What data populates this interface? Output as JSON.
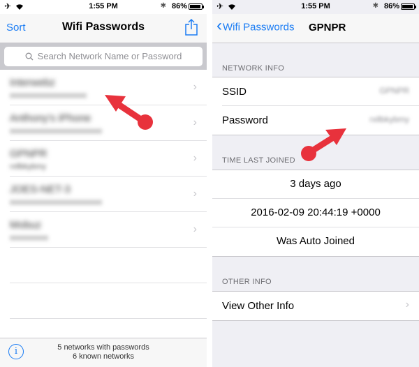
{
  "status": {
    "time": "1:55 PM",
    "battery": "86%",
    "battery_level": 0.86
  },
  "left": {
    "sort_label": "Sort",
    "title": "Wifi Passwords",
    "search_placeholder": "Search Network Name or Password",
    "networks": [
      {
        "name": "Interwebz",
        "password": "xxxxxxxxxxxxxxxxxxxx"
      },
      {
        "name": "Anthony's iPhone",
        "password": "xxxxxxxxxxxxxxxxxxxxxxxx"
      },
      {
        "name": "GPNPR",
        "password": "rxllbkybmy"
      },
      {
        "name": "JOES-NET-3",
        "password": "xxxxxxxxxxxxxxxxxxxxxxxx"
      },
      {
        "name": "Mobuz",
        "password": "xxxxxxxxxx"
      }
    ],
    "footer_line1": "5 networks with passwords",
    "footer_line2": "6 known networks"
  },
  "right": {
    "back_label": "Wifi Passwords",
    "title": "GPNPR",
    "network_info_header": "NETWORK INFO",
    "ssid_label": "SSID",
    "ssid_value": "GPNPR",
    "password_label": "Password",
    "password_value": "rxllbkybmy",
    "time_header": "TIME LAST JOINED",
    "time_rows": [
      "3 days ago",
      "2016-02-09 20:44:19 +0000",
      "Was Auto Joined"
    ],
    "other_header": "OTHER INFO",
    "other_row": "View Other Info"
  },
  "colors": {
    "accent": "#1a7cf4",
    "annotation_arrow": "#e8323c"
  },
  "icons": [
    "airplane-icon",
    "wifi-icon",
    "bluetooth-icon",
    "battery-icon",
    "share-icon",
    "search-icon",
    "chevron-right-icon",
    "info-icon",
    "chevron-left-icon"
  ]
}
